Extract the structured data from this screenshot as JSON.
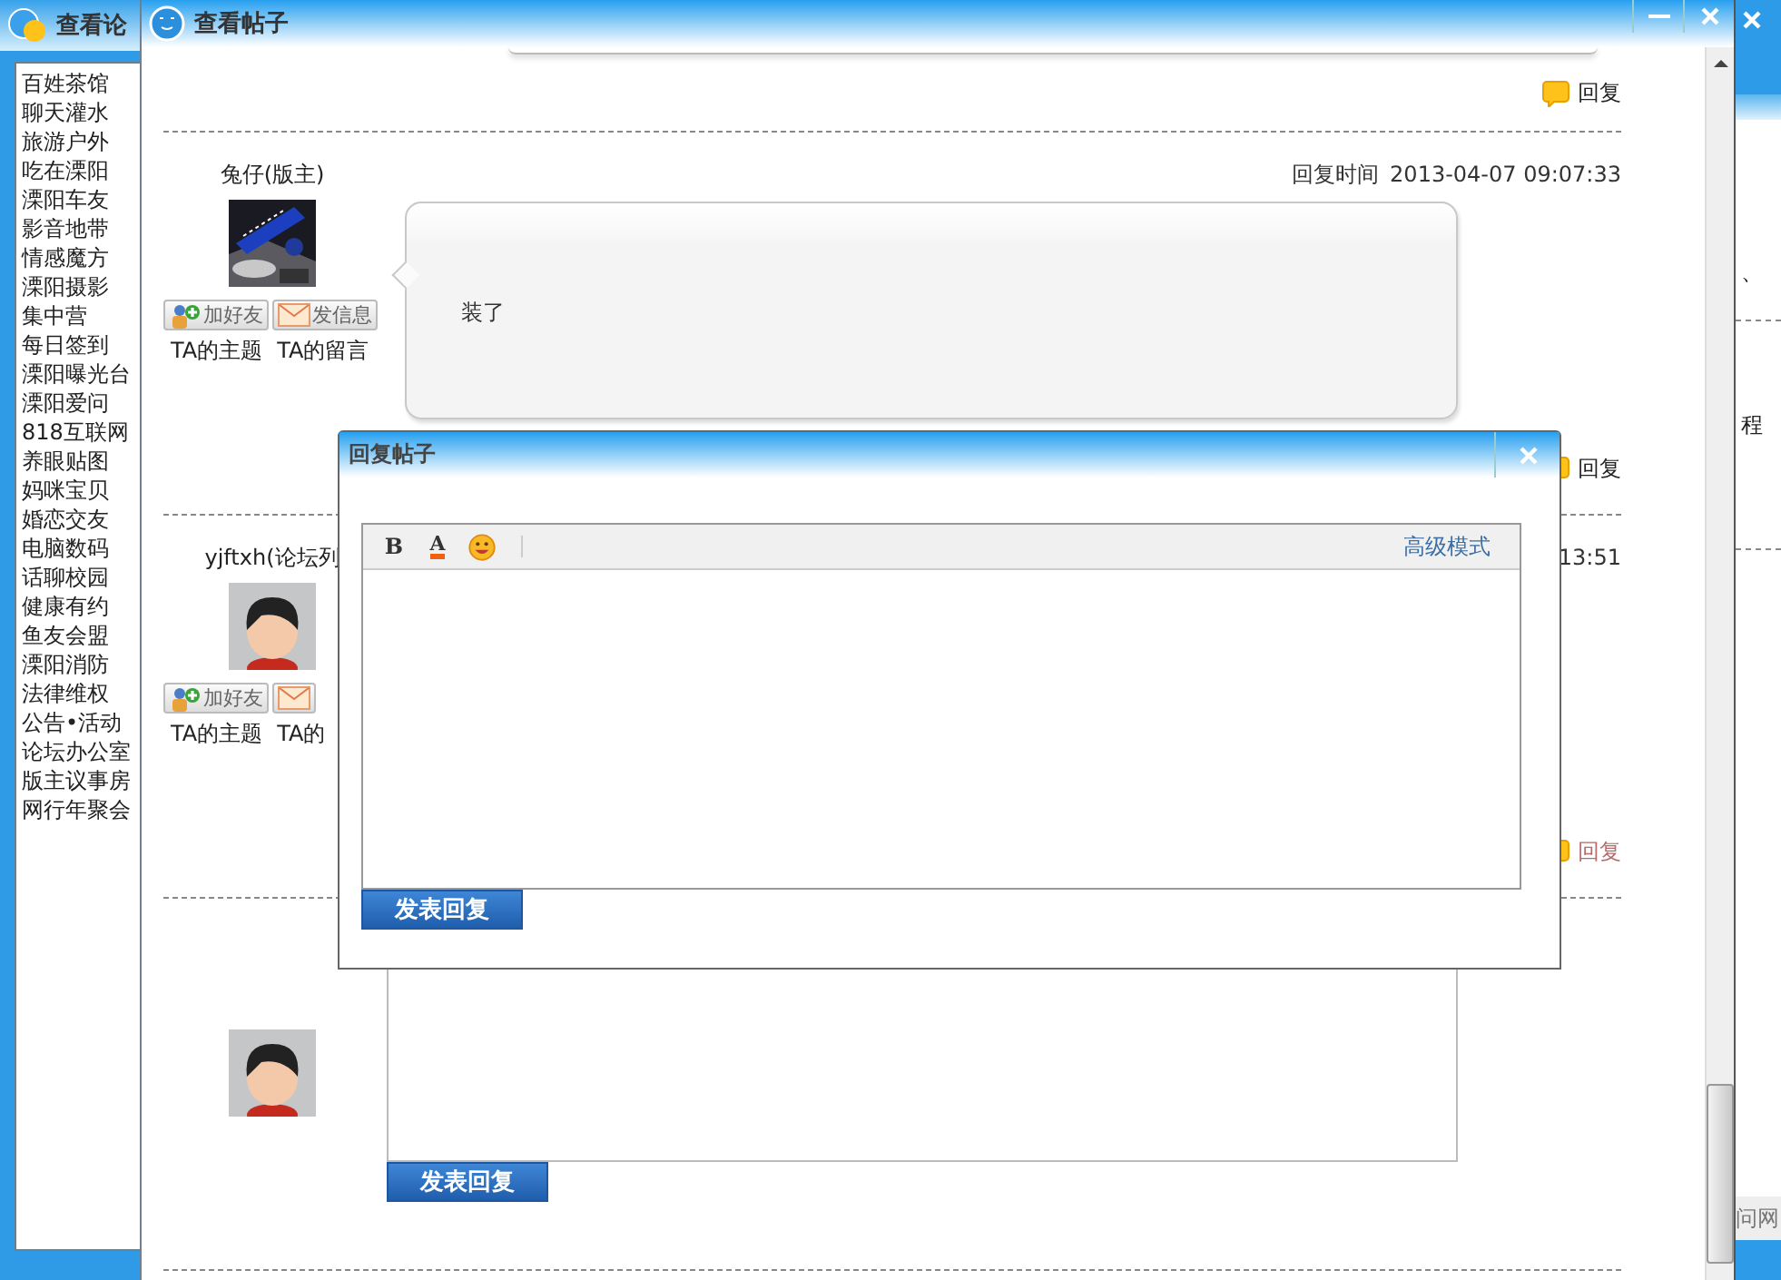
{
  "sidebar_window": {
    "title": "查看论",
    "items": [
      "百姓茶馆",
      "聊天灌水",
      "旅游户外",
      "吃在溧阳",
      "溧阳车友",
      "影音地带",
      "情感魔方",
      "溧阳摄影",
      "集中营",
      "每日签到",
      "溧阳曝光台",
      "溧阳爱问",
      "818互联网",
      "养眼贴图",
      "妈咪宝贝",
      "婚恋交友",
      "电脑数码",
      "话聊校园",
      "健康有约",
      "鱼友会盟",
      "溧阳消防",
      "法律维权",
      "公告•活动",
      "论坛办公室",
      "版主议事房",
      "网行年聚会"
    ]
  },
  "main_window": {
    "title": "查看帖子",
    "top_reply_link": "回复",
    "posts": [
      {
        "author": "兔仔(版主)",
        "avatar": {
          "kind": "picture"
        },
        "time_label": "回复时间",
        "time": "2013-04-07 09:07:33",
        "actions": [
          {
            "kind": "add_friend",
            "label": "加好友"
          },
          {
            "kind": "message",
            "label": "发信息"
          }
        ],
        "links": [
          "TA的主题",
          "TA的留言"
        ],
        "content": "装了",
        "reply_link": "回复",
        "highlighted": false
      },
      {
        "author": "yjftxh(论坛列",
        "avatar": {
          "kind": "cartoon"
        },
        "time": "13:51",
        "actions": [
          {
            "kind": "add_friend",
            "label": "加好友"
          },
          {
            "kind": "message"
          }
        ],
        "links": [
          "TA的主题",
          "TA的"
        ],
        "reply_link": "回复",
        "highlighted": true
      }
    ],
    "reply_box": {
      "avatar": {
        "kind": "cartoon"
      },
      "button": "发表回复"
    }
  },
  "reply_dialog": {
    "title": "回复帖子",
    "toolbar": [
      {
        "kind": "bold",
        "glyph": "B"
      },
      {
        "kind": "color",
        "glyph": "A"
      },
      {
        "kind": "emoji"
      }
    ],
    "mode_link": "高级模式",
    "button": "发表回复"
  },
  "right_window": {
    "texts": [
      "、",
      "程"
    ],
    "footer": "问网"
  }
}
